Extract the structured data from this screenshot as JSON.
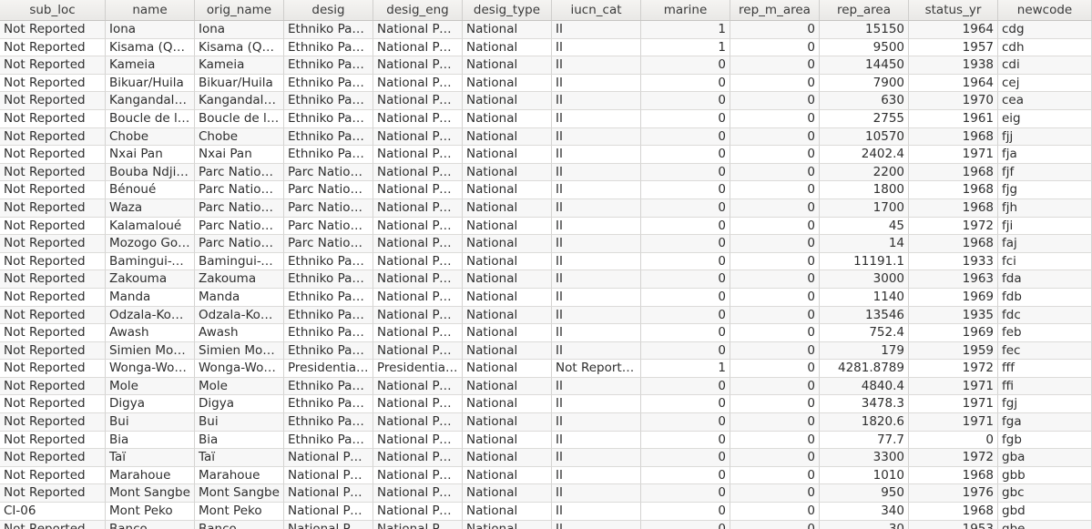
{
  "table": {
    "columns": [
      "sub_loc",
      "name",
      "orig_name",
      "desig",
      "desig_eng",
      "desig_type",
      "iucn_cat",
      "marine",
      "rep_m_area",
      "rep_area",
      "status_yr",
      "newcode"
    ],
    "rows": [
      [
        "Not Reported",
        "Iona",
        "Iona",
        "Ethniko Parko",
        "National Park",
        "National",
        "II",
        "1",
        "0",
        "15150",
        "1964",
        "cdg"
      ],
      [
        "Not Reported",
        "Kisama (Qu…",
        "Kisama (Qu…",
        "Ethniko Parko",
        "National Park",
        "National",
        "II",
        "1",
        "0",
        "9500",
        "1957",
        "cdh"
      ],
      [
        "Not Reported",
        "Kameia",
        "Kameia",
        "Ethniko Parko",
        "National Park",
        "National",
        "II",
        "0",
        "0",
        "14450",
        "1938",
        "cdi"
      ],
      [
        "Not Reported",
        "Bikuar/Huila",
        "Bikuar/Huila",
        "Ethniko Parko",
        "National Park",
        "National",
        "II",
        "0",
        "0",
        "7900",
        "1964",
        "cej"
      ],
      [
        "Not Reported",
        "Kangandala…",
        "Kangandala…",
        "Ethniko Parko",
        "National Park",
        "National",
        "II",
        "0",
        "0",
        "630",
        "1970",
        "cea"
      ],
      [
        "Not Reported",
        "Boucle de l…",
        "Boucle de l…",
        "Ethniko Parko",
        "National Park",
        "National",
        "II",
        "0",
        "0",
        "2755",
        "1961",
        "eig"
      ],
      [
        "Not Reported",
        "Chobe",
        "Chobe",
        "Ethniko Parko",
        "National Park",
        "National",
        "II",
        "0",
        "0",
        "10570",
        "1968",
        "fjj"
      ],
      [
        "Not Reported",
        "Nxai Pan",
        "Nxai Pan",
        "Ethniko Parko",
        "National Park",
        "National",
        "II",
        "0",
        "0",
        "2402.4",
        "1971",
        "fja"
      ],
      [
        "Not Reported",
        "Bouba Ndjida",
        "Parc Nation…",
        "Parc National",
        "National Park",
        "National",
        "II",
        "0",
        "0",
        "2200",
        "1968",
        "fjf"
      ],
      [
        "Not Reported",
        "Bénoué",
        "Parc Nation…",
        "Parc National",
        "National Park",
        "National",
        "II",
        "0",
        "0",
        "1800",
        "1968",
        "fjg"
      ],
      [
        "Not Reported",
        "Waza",
        "Parc Nation…",
        "Parc National",
        "National Park",
        "National",
        "II",
        "0",
        "0",
        "1700",
        "1968",
        "fjh"
      ],
      [
        "Not Reported",
        "Kalamaloué",
        "Parc Nation…",
        "Parc National",
        "National Park",
        "National",
        "II",
        "0",
        "0",
        "45",
        "1972",
        "fji"
      ],
      [
        "Not Reported",
        "Mozogo Go…",
        "Parc Nation…",
        "Parc National",
        "National Park",
        "National",
        "II",
        "0",
        "0",
        "14",
        "1968",
        "faj"
      ],
      [
        "Not Reported",
        "Bamingui-B…",
        "Bamingui-B…",
        "Ethniko Parko",
        "National Park",
        "National",
        "II",
        "0",
        "0",
        "11191.1",
        "1933",
        "fci"
      ],
      [
        "Not Reported",
        "Zakouma",
        "Zakouma",
        "Ethniko Parko",
        "National Park",
        "National",
        "II",
        "0",
        "0",
        "3000",
        "1963",
        "fda"
      ],
      [
        "Not Reported",
        "Manda",
        "Manda",
        "Ethniko Parko",
        "National Park",
        "National",
        "II",
        "0",
        "0",
        "1140",
        "1969",
        "fdb"
      ],
      [
        "Not Reported",
        "Odzala-Kok…",
        "Odzala-Kok…",
        "Ethniko Parko",
        "National Park",
        "National",
        "II",
        "0",
        "0",
        "13546",
        "1935",
        "fdc"
      ],
      [
        "Not Reported",
        "Awash",
        "Awash",
        "Ethniko Parko",
        "National Park",
        "National",
        "II",
        "0",
        "0",
        "752.4",
        "1969",
        "feb"
      ],
      [
        "Not Reported",
        "Simien Mou…",
        "Simien Mou…",
        "Ethniko Parko",
        "National Park",
        "National",
        "II",
        "0",
        "0",
        "179",
        "1959",
        "fec"
      ],
      [
        "Not Reported",
        "Wonga-Wo…",
        "Wonga-Wo…",
        "Presidentia…",
        "Presidentia…",
        "National",
        "Not Reported",
        "1",
        "0",
        "4281.8789",
        "1972",
        "fff"
      ],
      [
        "Not Reported",
        "Mole",
        "Mole",
        "Ethniko Parko",
        "National Park",
        "National",
        "II",
        "0",
        "0",
        "4840.4",
        "1971",
        "ffi"
      ],
      [
        "Not Reported",
        "Digya",
        "Digya",
        "Ethniko Parko",
        "National Park",
        "National",
        "II",
        "0",
        "0",
        "3478.3",
        "1971",
        "fgj"
      ],
      [
        "Not Reported",
        "Bui",
        "Bui",
        "Ethniko Parko",
        "National Park",
        "National",
        "II",
        "0",
        "0",
        "1820.6",
        "1971",
        "fga"
      ],
      [
        "Not Reported",
        "Bia",
        "Bia",
        "Ethniko Parko",
        "National Park",
        "National",
        "II",
        "0",
        "0",
        "77.7",
        "0",
        "fgb"
      ],
      [
        "Not Reported",
        "Taï",
        "Taï",
        "National Park",
        "National Park",
        "National",
        "II",
        "0",
        "0",
        "3300",
        "1972",
        "gba"
      ],
      [
        "Not Reported",
        "Marahoue",
        "Marahoue",
        "National Park",
        "National Park",
        "National",
        "II",
        "0",
        "0",
        "1010",
        "1968",
        "gbb"
      ],
      [
        "Not Reported",
        "Mont Sangbe",
        "Mont Sangbe",
        "National Park",
        "National Park",
        "National",
        "II",
        "0",
        "0",
        "950",
        "1976",
        "gbc"
      ],
      [
        "CI-06",
        "Mont Peko",
        "Mont Peko",
        "National Park",
        "National Park",
        "National",
        "II",
        "0",
        "0",
        "340",
        "1968",
        "gbd"
      ],
      [
        "Not Reported",
        "Banco",
        "Banco",
        "National Park",
        "National Park",
        "National",
        "II",
        "0",
        "0",
        "30",
        "1953",
        "gbe"
      ]
    ]
  }
}
